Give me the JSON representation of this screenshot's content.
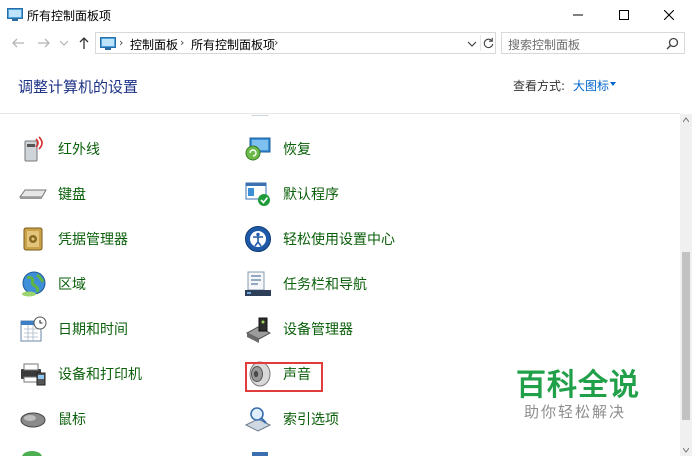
{
  "window": {
    "title": "所有控制面板项",
    "controls": {
      "minimize": "minimize-icon",
      "maximize": "maximize-icon",
      "close": "close-icon"
    }
  },
  "nav": {
    "breadcrumbs": [
      "控制面板",
      "所有控制面板项"
    ],
    "search_placeholder": "搜索控制面板"
  },
  "header": {
    "heading": "调整计算机的设置",
    "view_by_label": "查看方式:",
    "view_by_value": "大图标"
  },
  "items": [
    {
      "label": "红外线",
      "icon": "infrared-icon"
    },
    {
      "label": "恢复",
      "icon": "recovery-icon"
    },
    {
      "label": "键盘",
      "icon": "keyboard-icon"
    },
    {
      "label": "默认程序",
      "icon": "default-programs-icon"
    },
    {
      "label": "凭据管理器",
      "icon": "credential-manager-icon"
    },
    {
      "label": "轻松使用设置中心",
      "icon": "ease-of-access-icon"
    },
    {
      "label": "区域",
      "icon": "region-globe-icon"
    },
    {
      "label": "任务栏和导航",
      "icon": "taskbar-navigation-icon"
    },
    {
      "label": "日期和时间",
      "icon": "date-time-icon"
    },
    {
      "label": "设备管理器",
      "icon": "device-manager-icon"
    },
    {
      "label": "设备和打印机",
      "icon": "devices-printers-icon"
    },
    {
      "label": "声音",
      "icon": "sound-speaker-icon",
      "highlighted": true
    },
    {
      "label": "鼠标",
      "icon": "mouse-icon"
    },
    {
      "label": "索引选项",
      "icon": "indexing-options-icon"
    }
  ],
  "watermark": {
    "main": "百科全说",
    "sub": "助你轻松解决"
  },
  "colors": {
    "link_green": "#0a5f0a",
    "heading_blue": "#1e3287",
    "accent_blue": "#0066cc",
    "highlight_red": "#e03c3c",
    "watermark_green": "#21a04a"
  }
}
